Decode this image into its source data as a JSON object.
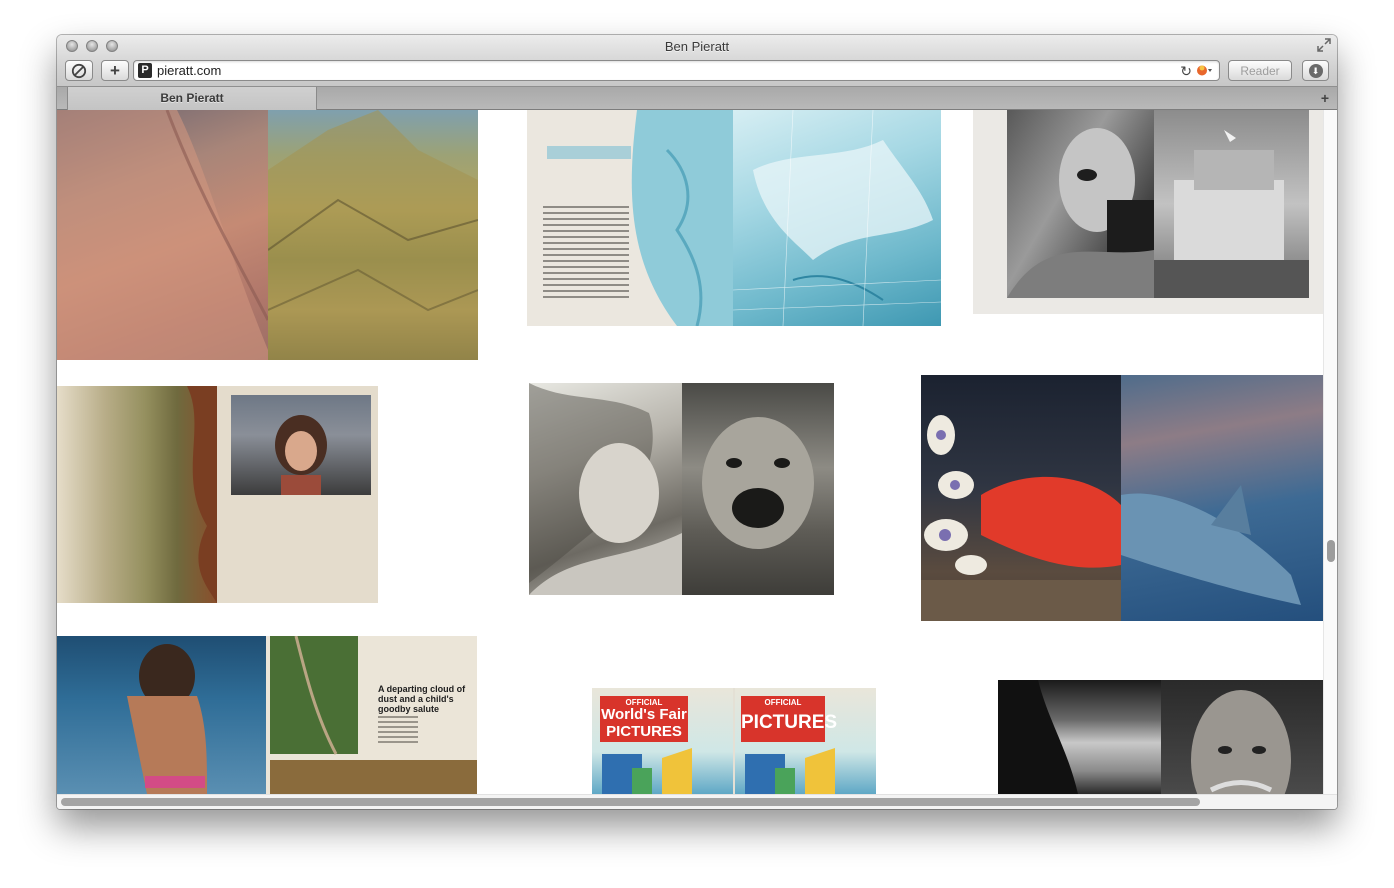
{
  "window": {
    "title": "Ben Pieratt"
  },
  "toolbar": {
    "url": "pieratt.com",
    "reader_label": "Reader",
    "favicon_letter": "P"
  },
  "tabs": [
    {
      "label": "Ben Pieratt"
    }
  ],
  "icons": {
    "no_entry": "no-entry-icon",
    "add": "plus-icon",
    "reload": "reload-icon",
    "download": "download-icon",
    "fullscreen": "fullscreen-icon",
    "new_tab": "new-tab-icon"
  },
  "gallery": {
    "collage_bulletin": {
      "caption": "A departing cloud of dust and a child's goodby salute"
    },
    "collage_worlds_fair": {
      "left_official": "OFFICIAL",
      "left_title": "World's Fair",
      "left_subtitle": "PICTURES",
      "right_official": "OFFICIAL",
      "right_title": "PICTURES"
    }
  },
  "colors": {
    "poster_red": "#d8342b",
    "map_blue": "#6fb9cc",
    "sand": "#c58a74"
  }
}
